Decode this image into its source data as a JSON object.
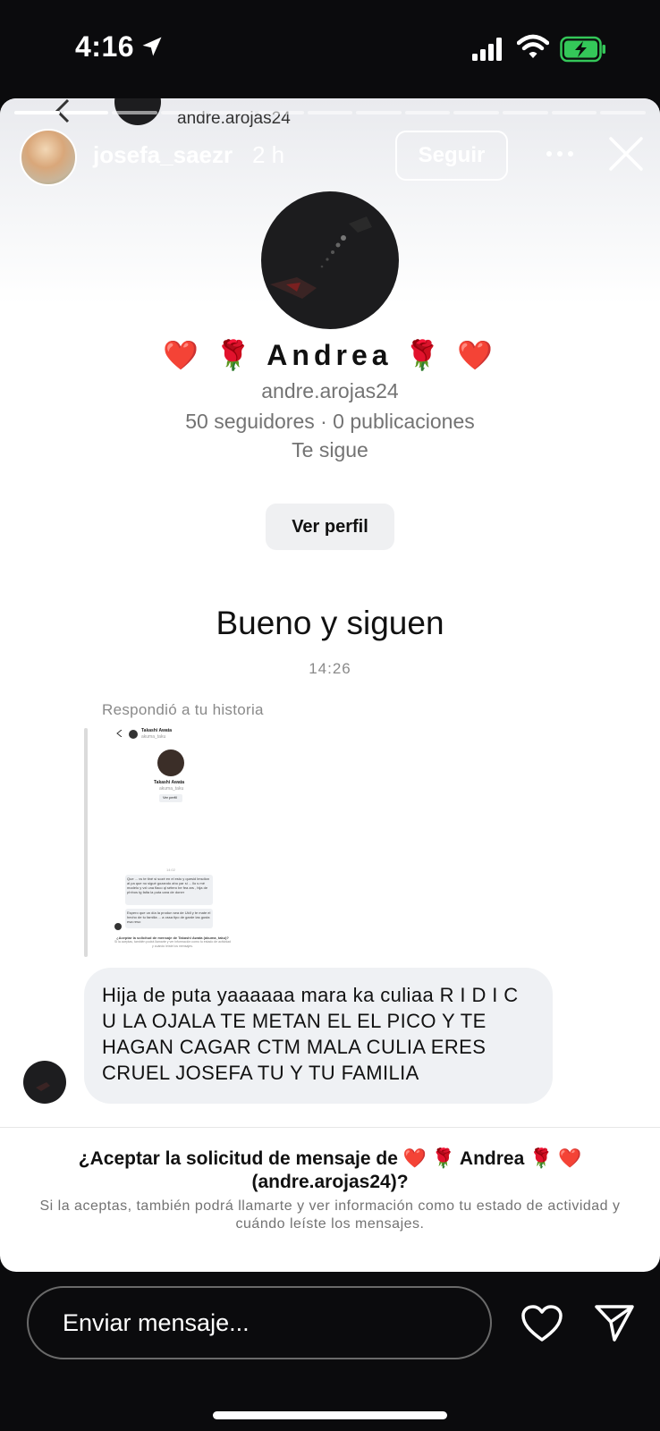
{
  "status_bar": {
    "time": "4:16",
    "icons": [
      "location-arrow-icon",
      "cellular-signal-icon",
      "wifi-icon",
      "battery-charging-icon"
    ]
  },
  "background_header": {
    "handle": "andre.arojas24"
  },
  "story_header": {
    "username": "josefa_saezr",
    "time_ago": "2 h",
    "follow_label": "Seguir"
  },
  "profile": {
    "display_name": "❤️ 🌹 Andrea 🌹 ❤️",
    "handle": "andre.arojas24",
    "stats": "50 seguidores · 0 publicaciones",
    "follows_you": "Te sigue",
    "view_profile_label": "Ver perfil"
  },
  "conversation": {
    "big_message": "Bueno y siguen",
    "timestamp": "14:26",
    "replied_label": "Respondió a tu historia",
    "message": "Hija de puta yaaaaaa mara ka culiaa R I D I C U LA OJALA TE METAN EL EL PICO Y TE HAGAN CAGAR CTM MALA CULIA ERES CRUEL JOSEFA TU Y TU FAMILIA"
  },
  "thumbnail": {
    "header_name": "Takashi Awata",
    "header_handle": "akuma_taku",
    "profile_name": "Takashi Awata",
    "profile_handle": "akuma_taku",
    "button": "Ver perfil",
    "time": "14:02",
    "bubble1": "Que ... vs te tiné si sozé en el esto y quesid lmsdion al pa que no sigué gozando aho yar si ... llo s mé modelo y vxl una flaco ql sétero be fea ars , hija de p!nhos tg falta la puta cara de doner",
    "bubble2": "Espero que un día la produn sea de Uidl y te mate el hecho de tu familia ... a ossa tipo de garde las gusta esa reso",
    "request": "¿Aceptar la solicitud de mensaje de Takashi Awata (akuma_taku)?",
    "request_sub": "Si la aceptas, también podrá llamarte y ver información como tu estado de actividad y cuándo leíste los mensajes."
  },
  "request": {
    "title": "¿Aceptar la solicitud de mensaje de ❤️ 🌹 Andrea 🌹 ❤️ (andre.arojas24)?",
    "description": "Si la aceptas, también podrá llamarte y ver información como tu estado de actividad y cuándo leíste los mensajes."
  },
  "bottom_bar": {
    "input_placeholder": "Enviar mensaje...",
    "icons": [
      "heart-icon",
      "send-icon"
    ]
  },
  "colors": {
    "background": "#0b0b0d",
    "card": "#ffffff",
    "bubble": "#eff1f4",
    "muted_text": "#737373",
    "battery_green": "#34c759"
  }
}
